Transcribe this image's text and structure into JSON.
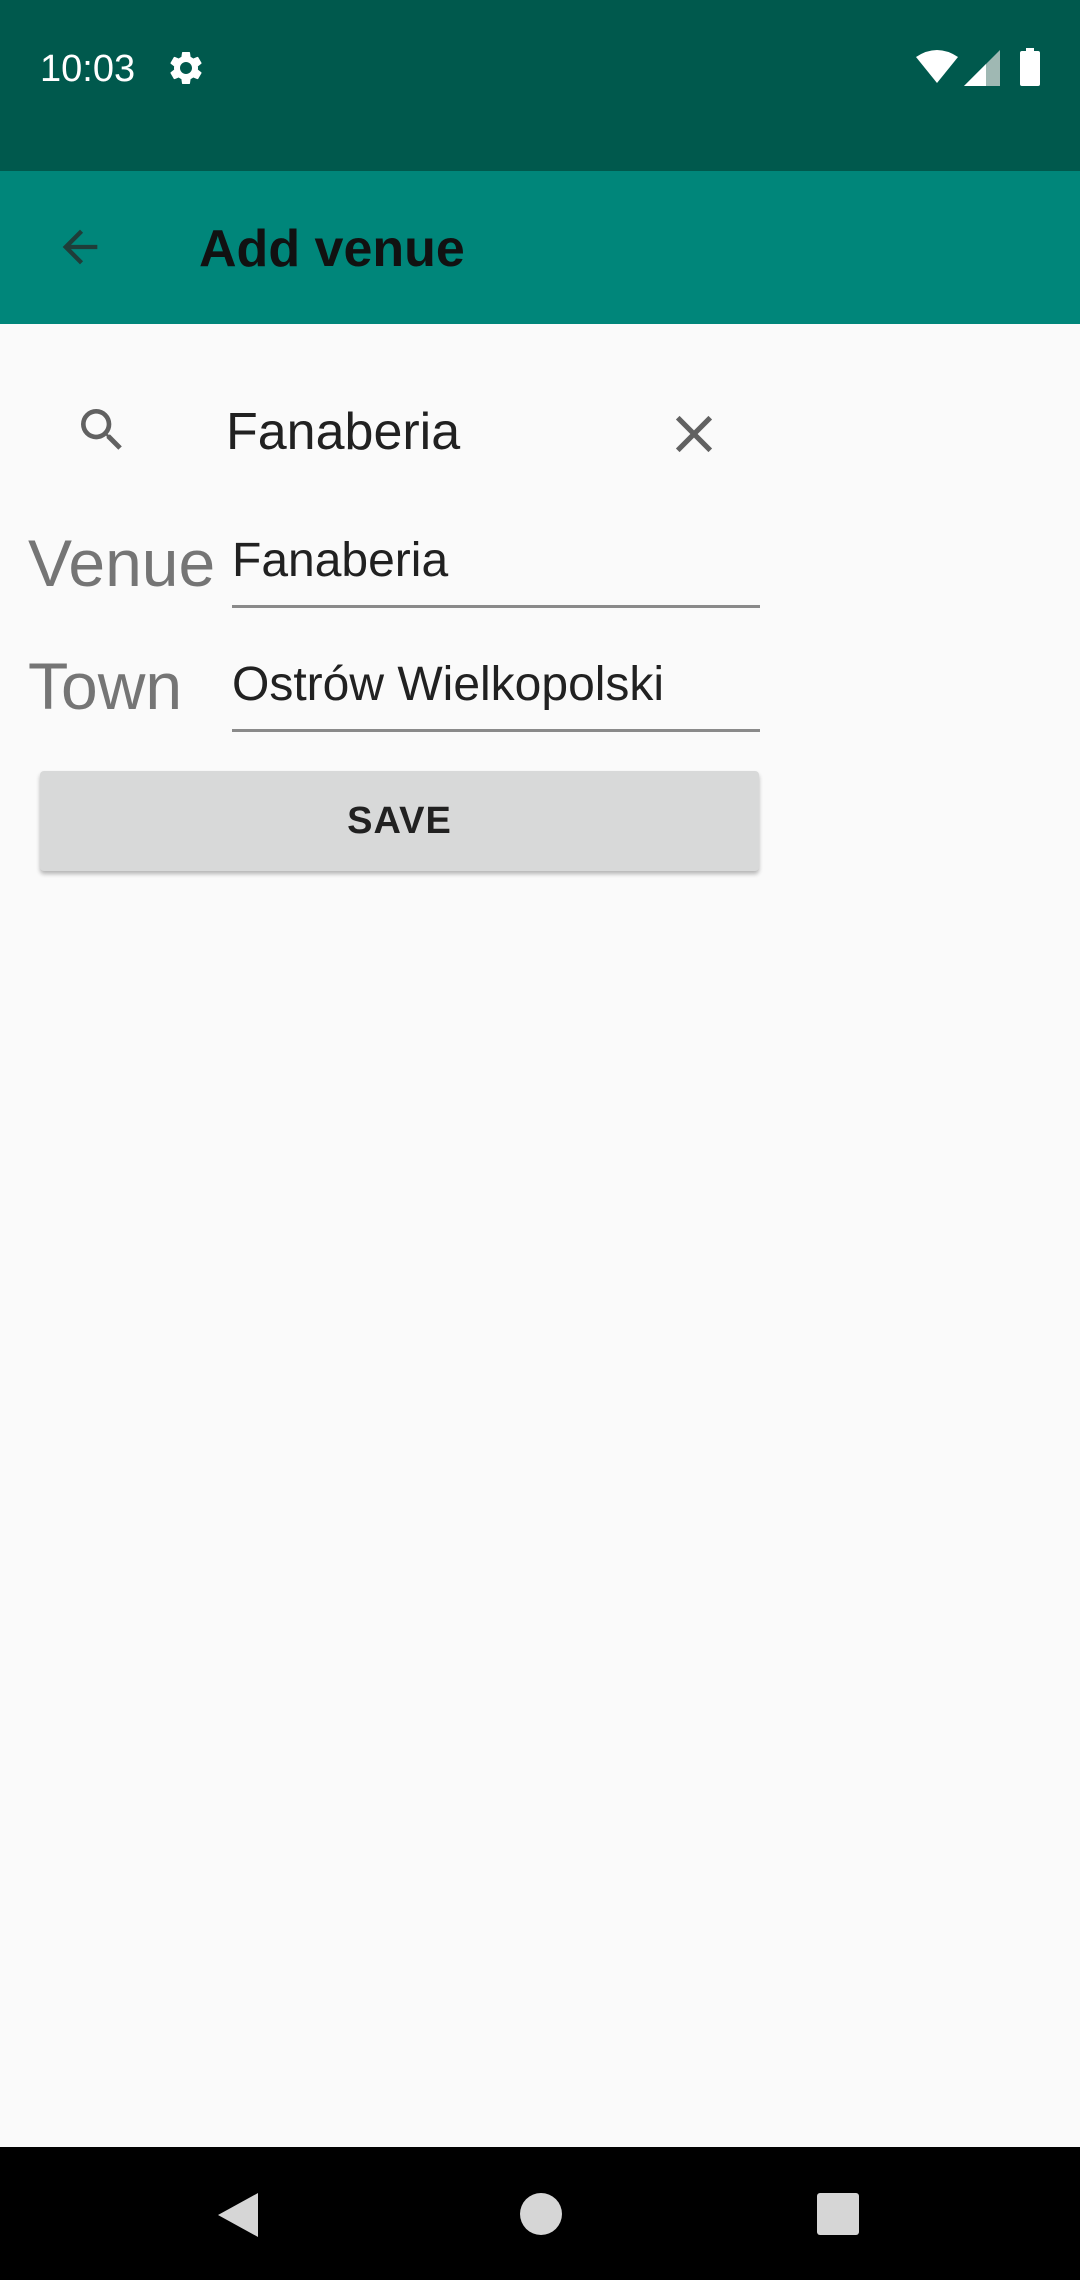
{
  "status_bar": {
    "time": "10:03",
    "icons": [
      "settings-icon",
      "wifi-icon",
      "signal-icon",
      "battery-icon"
    ],
    "background": "#00594d"
  },
  "app_bar": {
    "title": "Add venue",
    "back_icon": "arrow-left-icon",
    "background": "#00867a"
  },
  "search": {
    "query": "Fanaberia",
    "search_icon": "search-icon",
    "clear_icon": "close-icon"
  },
  "form": {
    "venue": {
      "label": "Venue",
      "value": "Fanaberia"
    },
    "town": {
      "label": "Town",
      "value": "Ostrów Wielkopolski"
    },
    "save_label": "SAVE"
  },
  "nav_bar": {
    "icons": [
      "nav-back-icon",
      "nav-home-icon",
      "nav-recents-icon"
    ]
  }
}
